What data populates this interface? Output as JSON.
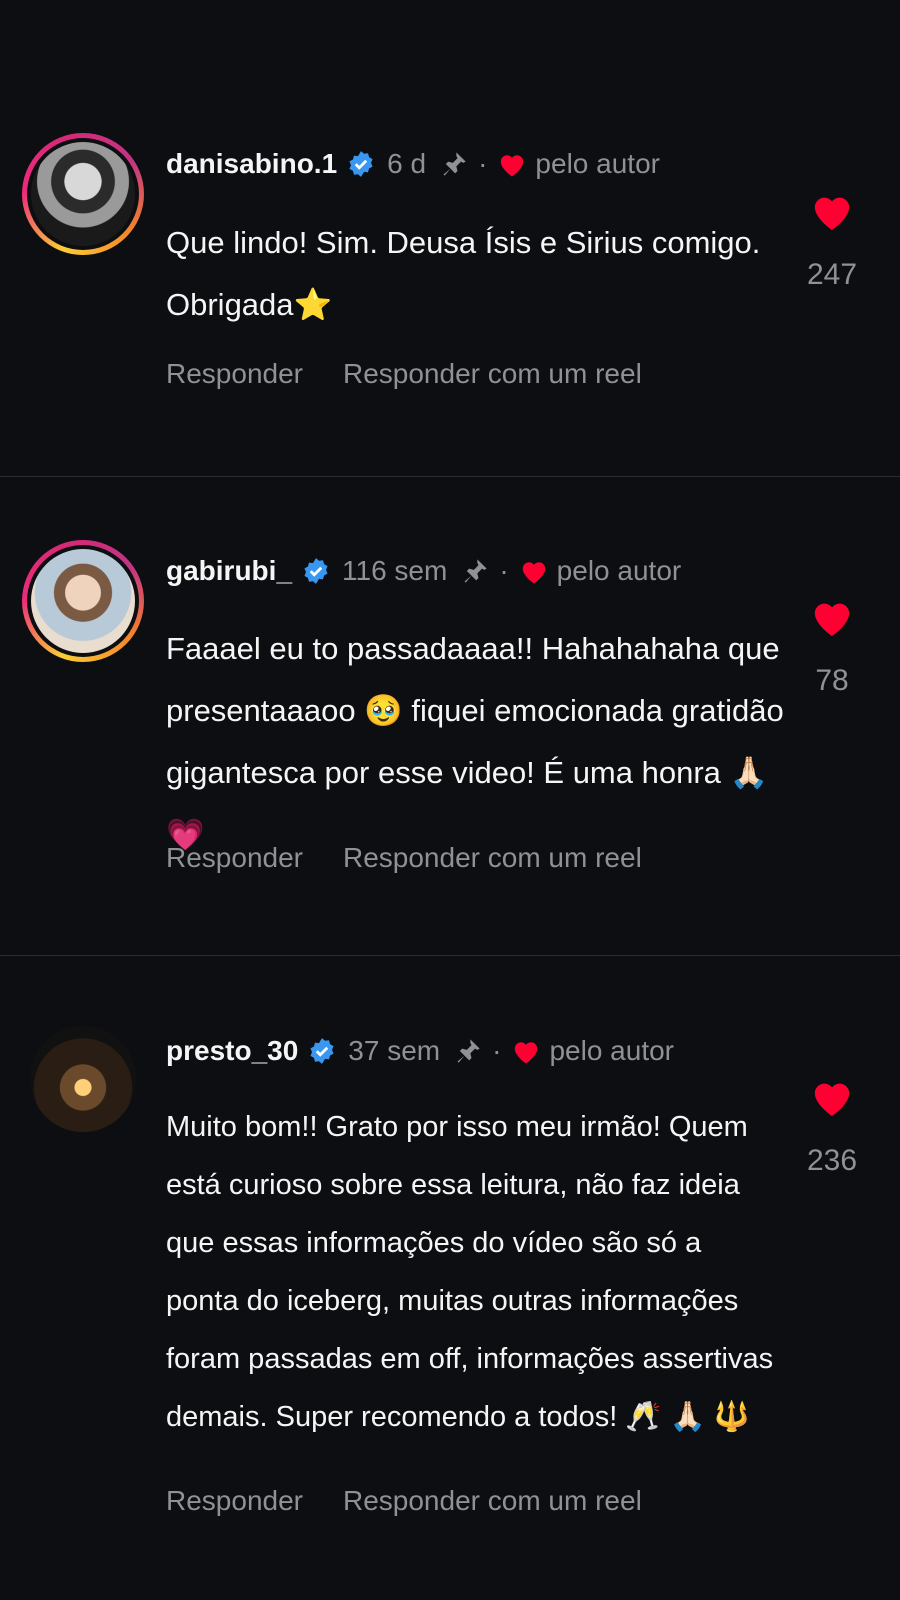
{
  "colors": {
    "background": "#0c0e11",
    "verified": "#3897f0",
    "heart": "#ff0033",
    "muted": "#8e9196"
  },
  "comments": [
    {
      "username": "danisabino.1",
      "time": "6 d",
      "liked_by_author": "pelo autor",
      "text": "Que lindo! Sim. Deusa Ísis e Sirius comigo. Obrigada⭐",
      "likes": "247",
      "reply_label": "Responder",
      "reel_reply_label": "Responder com um reel"
    },
    {
      "username": "gabirubi_",
      "time": "116 sem",
      "liked_by_author": "pelo autor",
      "text": "Faaael eu to passadaaaa!! Hahahahaha que presentaaaoo 🥹 fiquei emocionada gratidão gigantesca por esse video! É uma honra 🙏🏻💗",
      "likes": "78",
      "reply_label": "Responder",
      "reel_reply_label": "Responder com um reel"
    },
    {
      "username": "presto_30",
      "time": "37 sem",
      "liked_by_author": "pelo autor",
      "text": "Muito bom!! Grato por isso meu irmão! Quem está curioso sobre essa leitura, não faz ideia que essas informações do vídeo são só a ponta do iceberg, muitas outras informações foram passadas em off, informações assertivas demais. Super recomendo a todos! 🥂 🙏🏻 🔱",
      "likes": "236",
      "reply_label": "Responder",
      "reel_reply_label": "Responder com um reel"
    }
  ]
}
